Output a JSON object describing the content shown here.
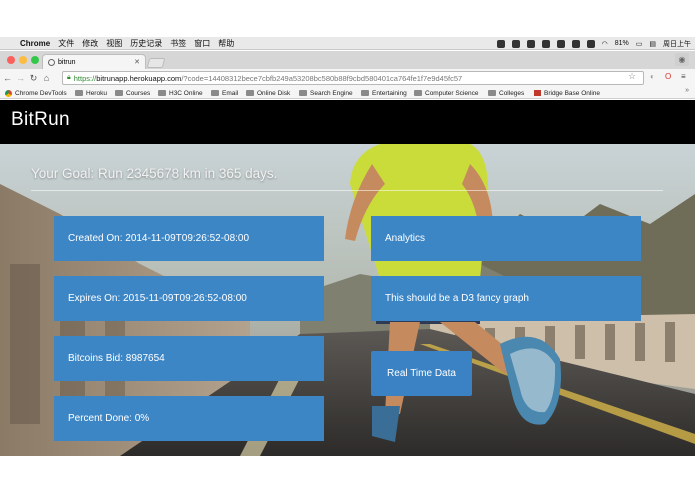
{
  "os_menubar": {
    "app_name": "Chrome",
    "menus": [
      "文件",
      "修改",
      "视图",
      "历史记录",
      "书签",
      "窗口",
      "帮助"
    ],
    "battery": "81%",
    "clock": "周日上午"
  },
  "browser": {
    "tab_title": "bitrun",
    "url_https": "https://",
    "url_host": "bitrunapp.herokuapp.com",
    "url_rest": "/?code=14408312bece7cbfb249a53208bc580b88f9cbd580401ca764fe1f7e9d45fc57",
    "bookmarks": [
      "Chrome DevTools",
      "Heroku",
      "Courses",
      "H3C Online",
      "Email",
      "Online Disk",
      "Search Engine",
      "Entertaining",
      "Computer Science",
      "Colleges",
      "Bridge Base Online"
    ],
    "more": "»"
  },
  "app": {
    "brand": "BitRun",
    "goal": "Your Goal: Run 2345678 km in 365 days.",
    "cards": {
      "created": "Created On: 2014-11-09T09:26:52-08:00",
      "expires": "Expires On: 2015-11-09T09:26:52-08:00",
      "bitcoins": "Bitcoins Bid: 8987654",
      "percent": "Percent Done: 0%",
      "analytics": "Analytics",
      "graph": "This should be a D3 fancy graph",
      "realtime": "Real Time Data"
    }
  },
  "colors": {
    "card_blue": "#3d86c6",
    "header_black": "#000000"
  }
}
